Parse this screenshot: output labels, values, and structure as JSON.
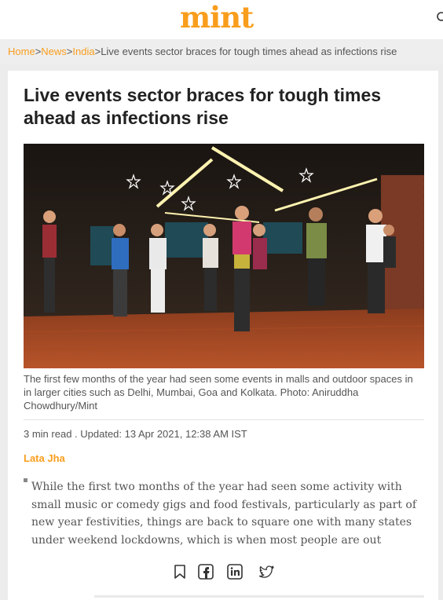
{
  "header": {
    "logo_text": "mint",
    "search_icon": "search-icon",
    "brand_color": "#f99d1c"
  },
  "breadcrumb": {
    "items": [
      "Home",
      "News",
      "India"
    ],
    "current": "Live events sector braces for tough times ahead as infections rise",
    "separator": ">"
  },
  "article": {
    "headline": "Live events sector braces for tough times ahead as infections rise",
    "caption": "The first few months of the year had seen some events in malls and outdoor spaces in in larger cities such as Delhi, Mumbai, Goa and Kolkata. Photo: Aniruddha Chowdhury/Mint",
    "meta": "3 min read . Updated: 13 Apr 2021, 12:38 AM IST",
    "author": "Lata Jha",
    "body": "While the first two months of the year had seen some activity with small music or comedy gigs and food festivals, particularly as part of new year festivities, things are back to square one with many states under weekend lockdowns, which is when most people are out"
  },
  "share": {
    "icons": [
      "bookmark-icon",
      "facebook-icon",
      "linkedin-icon",
      "twitter-icon"
    ]
  }
}
